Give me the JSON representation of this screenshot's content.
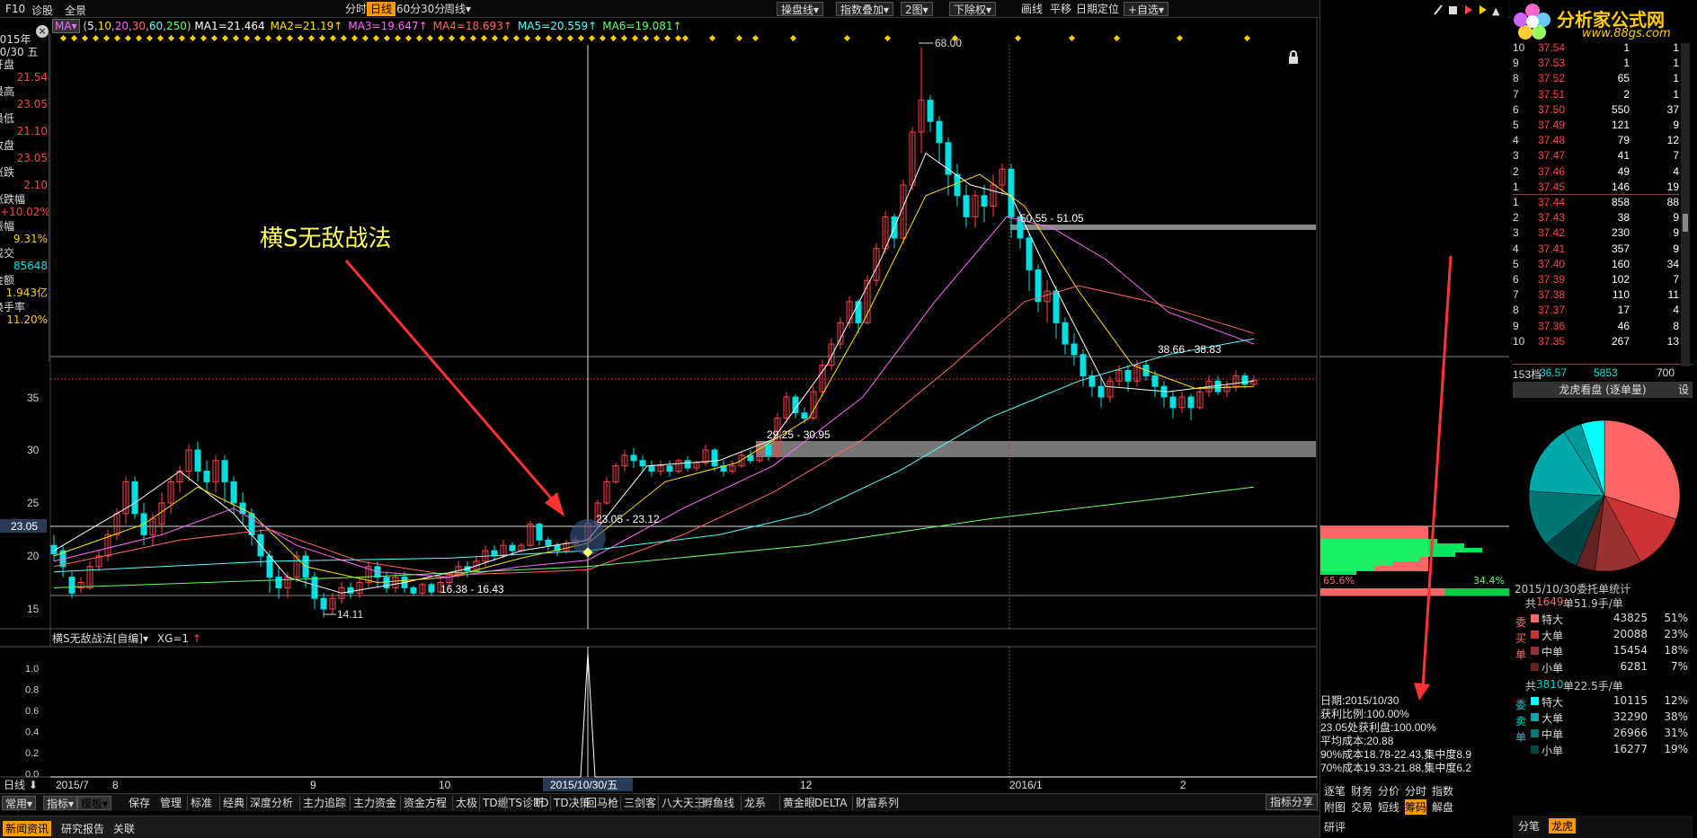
{
  "topbar": {
    "f10": "F10",
    "diag": "诊股",
    "all": "全景",
    "periods": [
      "分时",
      "日线",
      "60分",
      "30分",
      "周线▾"
    ],
    "active_period": "日线",
    "tools": [
      "操盘线▾",
      "指数叠加▾",
      "2图▾",
      "下除权▾",
      "画线",
      "平移",
      "日期定位",
      "+自选▾"
    ],
    "logo_text": "分析家公式网",
    "logo_url": "www.88gs.com"
  },
  "ma_legend": {
    "ma_label": "MA▾",
    "params": "(5,10,20,30,60,250)",
    "items": [
      {
        "text": "MA1=21.464",
        "color": "#ffffff"
      },
      {
        "text": "MA2=21.19",
        "color": "#ffe000"
      },
      {
        "text": "MA3=19.647",
        "color": "#ff66ff"
      },
      {
        "text": "MA4=18.693",
        "color": "#ff6666"
      },
      {
        "text": "MA5=20.559",
        "color": "#55ffff"
      },
      {
        "text": "MA6=19.081",
        "color": "#66ff66"
      }
    ]
  },
  "left_panel": [
    {
      "label": "2015年",
      "value": ""
    },
    {
      "label": "10/30 五",
      "value": ""
    },
    {
      "label": "开盘",
      "value": "21.54",
      "color": "#ff4444"
    },
    {
      "label": "最高",
      "value": "23.05",
      "color": "#ff4444"
    },
    {
      "label": "最低",
      "value": "21.10",
      "color": "#ff4444"
    },
    {
      "label": "收盘",
      "value": "23.05",
      "color": "#ff4444"
    },
    {
      "label": "涨跌",
      "value": "2.10",
      "color": "#ff4444"
    },
    {
      "label": "涨跌幅",
      "value": "+10.02%",
      "color": "#ff4444"
    },
    {
      "label": "振幅",
      "value": "9.31%",
      "color": "#ffcc00"
    },
    {
      "label": "成交",
      "value": "85648",
      "color": "#00e0e0"
    },
    {
      "label": "金额",
      "value": "1.943亿",
      "color": "#ffcc00"
    },
    {
      "label": "换手率",
      "value": "11.20%",
      "color": "#ffcc00"
    }
  ],
  "price_axis": [
    "35",
    "30",
    "25",
    "20",
    "15"
  ],
  "current_price_tag": "23.05",
  "annotations": {
    "title": "横S无敌战法",
    "peak": "68.00",
    "low": "14.11",
    "band1": "50.55 - 51.05",
    "band2": "38.66 - 38.83",
    "band3": "29.25 - 30.95",
    "band4": "23.05 - 23.12",
    "band5": "16.38 - 16.43"
  },
  "indicator": {
    "title": "横S无敌战法[自编]▾",
    "xg": "XG=1",
    "axis": [
      "1.0",
      "0.8",
      "0.6",
      "0.4",
      "0.2",
      "0.0"
    ]
  },
  "date_axis": {
    "period_label": "日线",
    "labels": [
      "2015/7",
      "8",
      "9",
      "10",
      "12",
      "2016/1",
      "2"
    ],
    "cursor_date": "2015/10/30/五"
  },
  "bottom_tabs": [
    "常用▾",
    "指标▾",
    "模板▾",
    "保存",
    "管理",
    "标准",
    "经典",
    "深度分析",
    "主力追踪",
    "主力资金",
    "资金方程",
    "太极",
    "TD缠",
    "TS诊断",
    "TD",
    "TD决策",
    "回马枪",
    "三剑客",
    "八大天王",
    "孵鱼线",
    "龙系",
    "黄金眼",
    "DELTA",
    "财富系列"
  ],
  "right_button": "指标分享",
  "status_tabs": [
    "新闻资讯",
    "研究报告",
    "关联"
  ],
  "chip_panel": {
    "left_pct": "65.6%",
    "right_pct": "34.4%",
    "date": "日期:2015/10/30",
    "profit_ratio": "获利比例:100.00%",
    "profit_at": "23.05处获利盘:100.00%",
    "avg_cost": "平均成本:20.88",
    "cost90": "90%成本18.78-22.43,集中度8.9",
    "cost70": "70%成本19.33-21.88,集中度6.2",
    "tabs_row1": [
      "逐笔",
      "财务",
      "分价",
      "分时",
      "指数"
    ],
    "tabs_row2": [
      "附图",
      "交易",
      "短线",
      "筹码",
      "解盘"
    ],
    "active_tab": "筹码",
    "bottom_tab": "研评"
  },
  "orderbook": {
    "sells": [
      {
        "n": "10",
        "price": "37.54",
        "vol": "1",
        "cnt": "1"
      },
      {
        "n": "9",
        "price": "37.53",
        "vol": "1",
        "cnt": "1"
      },
      {
        "n": "8",
        "price": "37.52",
        "vol": "65",
        "cnt": "1"
      },
      {
        "n": "7",
        "price": "37.51",
        "vol": "2",
        "cnt": "1"
      },
      {
        "n": "6",
        "price": "37.50",
        "vol": "550",
        "cnt": "37"
      },
      {
        "n": "5",
        "price": "37.49",
        "vol": "121",
        "cnt": "9"
      },
      {
        "n": "4",
        "price": "37.48",
        "vol": "79",
        "cnt": "12"
      },
      {
        "n": "3",
        "price": "37.47",
        "vol": "41",
        "cnt": "7"
      },
      {
        "n": "2",
        "price": "37.46",
        "vol": "49",
        "cnt": "4"
      },
      {
        "n": "1",
        "price": "37.45",
        "vol": "146",
        "cnt": "19"
      }
    ],
    "buys": [
      {
        "n": "1",
        "price": "37.44",
        "vol": "858",
        "cnt": "88"
      },
      {
        "n": "2",
        "price": "37.43",
        "vol": "38",
        "cnt": "9"
      },
      {
        "n": "3",
        "price": "37.42",
        "vol": "230",
        "cnt": "9"
      },
      {
        "n": "4",
        "price": "37.41",
        "vol": "357",
        "cnt": "9"
      },
      {
        "n": "5",
        "price": "37.40",
        "vol": "160",
        "cnt": "34"
      },
      {
        "n": "6",
        "price": "37.39",
        "vol": "102",
        "cnt": "7"
      },
      {
        "n": "7",
        "price": "37.38",
        "vol": "110",
        "cnt": "11"
      },
      {
        "n": "8",
        "price": "37.37",
        "vol": "17",
        "cnt": "4"
      },
      {
        "n": "9",
        "price": "37.36",
        "vol": "46",
        "cnt": "8"
      },
      {
        "n": "10",
        "price": "37.35",
        "vol": "267",
        "cnt": "13"
      }
    ],
    "summary": {
      "label": "153档",
      "price": "36.57",
      "vol": "5853",
      "cnt": "700"
    }
  },
  "dragon": {
    "title": "龙虎看盘 (逐单量)",
    "settings": "设",
    "pie_date": "2015/10/30委托单统计",
    "buy_header_pre": "共",
    "buy_header_num": "1649",
    "buy_header_post": "单51.9手/单",
    "buy_side": [
      "委",
      "买",
      "单"
    ],
    "buy_rows": [
      {
        "label": "特大",
        "value": "43825",
        "pct": "51%",
        "color": "#ff6666"
      },
      {
        "label": "大单",
        "value": "20088",
        "pct": "23%",
        "color": "#cc3333"
      },
      {
        "label": "中单",
        "value": "15454",
        "pct": "18%",
        "color": "#993333"
      },
      {
        "label": "小单",
        "value": "6281",
        "pct": "7%",
        "color": "#662222"
      }
    ],
    "sell_header_pre": "共",
    "sell_header_num": "3810",
    "sell_header_post": "单22.5手/单",
    "sell_side": [
      "委",
      "卖",
      "单"
    ],
    "sell_rows": [
      {
        "label": "特大",
        "value": "10115",
        "pct": "12%",
        "color": "#00ffff"
      },
      {
        "label": "大单",
        "value": "32290",
        "pct": "38%",
        "color": "#00aaaa"
      },
      {
        "label": "中单",
        "value": "26966",
        "pct": "31%",
        "color": "#007777"
      },
      {
        "label": "小单",
        "value": "16277",
        "pct": "19%",
        "color": "#004444"
      }
    ],
    "bottom_tabs": [
      "分笔",
      "龙虎"
    ],
    "active_bottom": "龙虎"
  }
}
